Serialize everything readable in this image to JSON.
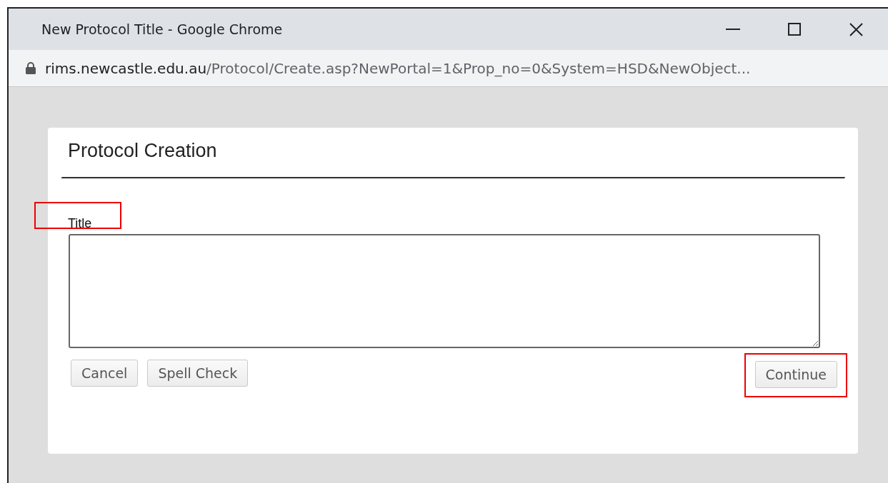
{
  "window": {
    "title": "New Protocol Title - Google Chrome"
  },
  "address_bar": {
    "host": "rims.newcastle.edu.au",
    "path": "/Protocol/Create.asp?NewPortal=1&Prop_no=0&System=HSD&NewObject..."
  },
  "form": {
    "heading": "Protocol Creation",
    "field_label": "Title",
    "field_label_highlighted": true,
    "left_buttons": [
      {
        "label": "Cancel",
        "highlighted": false
      },
      {
        "label": "Spell Check",
        "highlighted": false
      }
    ],
    "right_buttons": [
      {
        "label": "Continue",
        "highlighted": true
      }
    ]
  }
}
